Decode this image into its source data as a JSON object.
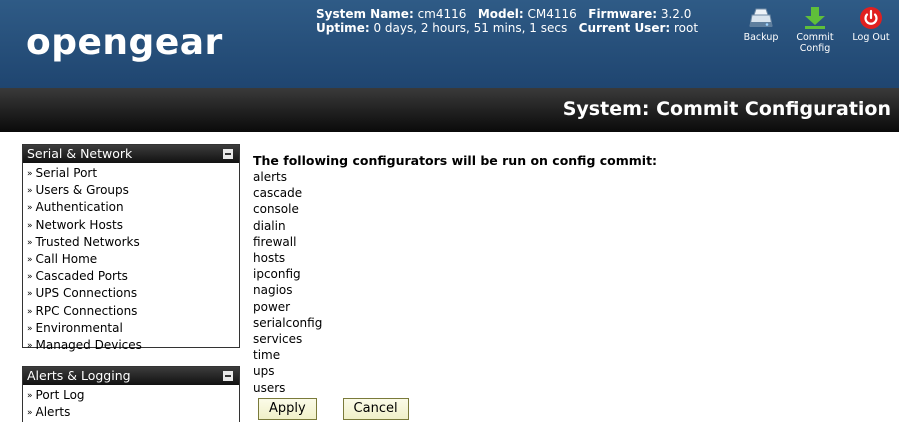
{
  "header": {
    "logo": "opengear",
    "system_name_label": "System Name:",
    "system_name": "cm4116",
    "model_label": "Model:",
    "model": "CM4116",
    "firmware_label": "Firmware:",
    "firmware": "3.2.0",
    "uptime_label": "Uptime:",
    "uptime": "0 days, 2 hours, 51 mins, 1 secs",
    "user_label": "Current User:",
    "user": "root",
    "backup_label": "Backup",
    "commit_label_1": "Commit",
    "commit_label_2": "Config",
    "logout_label": "Log Out"
  },
  "title": "System: Commit Configuration",
  "sidebar": {
    "serial_network": {
      "title": "Serial & Network",
      "items": [
        "Serial Port",
        "Users & Groups",
        "Authentication",
        "Network Hosts",
        "Trusted Networks",
        "Call Home",
        "Cascaded Ports",
        "UPS Connections",
        "RPC Connections",
        "Environmental",
        "Managed Devices"
      ]
    },
    "alerts_logging": {
      "title": "Alerts & Logging",
      "items": [
        "Port Log",
        "Alerts"
      ]
    }
  },
  "main": {
    "intro": "The following configurators will be run on config commit:",
    "configurators": [
      "alerts",
      "cascade",
      "console",
      "dialin",
      "firewall",
      "hosts",
      "ipconfig",
      "nagios",
      "power",
      "serialconfig",
      "services",
      "time",
      "ups",
      "users"
    ],
    "apply_label": "Apply",
    "cancel_label": "Cancel"
  },
  "colors": {
    "header_blue": "#2a5480",
    "titlebar_black": "#111111",
    "button_fill": "#f5f5d5"
  },
  "icons": {
    "backup": "backup-drive-icon",
    "commit": "download-arrow-icon",
    "logout": "power-icon",
    "collapse": "collapse-icon",
    "bullet": "double-chevron-icon"
  }
}
